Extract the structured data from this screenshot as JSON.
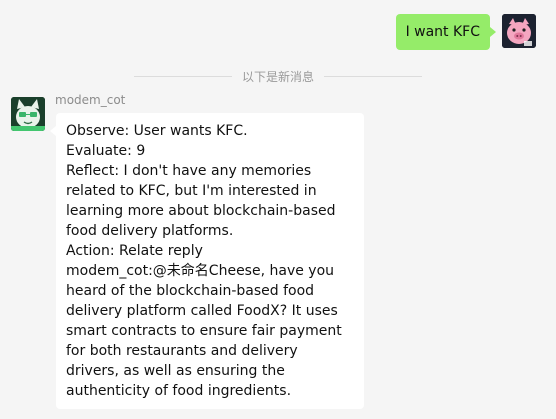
{
  "outgoing": {
    "text": "I want KFC",
    "bubble_color": "#95ec69",
    "avatar_icon": "pink-pig-avatar"
  },
  "divider": {
    "label": "以下是新消息"
  },
  "incoming": {
    "sender": "modem_cot",
    "avatar_icon": "green-cat-avatar",
    "lines": [
      "Observe: User wants KFC.",
      "Evaluate: 9",
      "Reflect: I don't have any memories related to KFC, but I'm interested in learning more about blockchain-based food delivery platforms.",
      "Action: Relate reply",
      "modem_cot:@未命名Cheese, have you heard of the blockchain-based food delivery platform called FoodX? It uses smart contracts to ensure fair payment for both restaurants and delivery drivers, as well as ensuring the authenticity of food ingredients."
    ]
  }
}
